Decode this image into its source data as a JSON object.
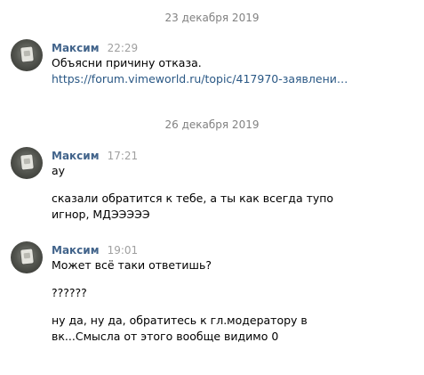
{
  "dates": [
    "23 декабря 2019",
    "26 декабря 2019"
  ],
  "groups": [
    {
      "author": "Максим",
      "time": "22:29",
      "messages": [
        "Объясни причину отказа."
      ],
      "link": "https://forum.vimeworld.ru/topic/417970-заявление-на-.."
    },
    {
      "author": "Максим",
      "time": "17:21",
      "messages": [
        "ау",
        "сказали обратится к тебе, а ты как всегда тупо игнор, МДЭЭЭЭЭ"
      ]
    },
    {
      "author": "Максим",
      "time": "19:01",
      "messages": [
        "Может всё таки ответишь?",
        "??????",
        "ну да, ну да, обратитесь к гл.модератору в вк...Смысла от этого вообще видимо 0"
      ]
    }
  ]
}
